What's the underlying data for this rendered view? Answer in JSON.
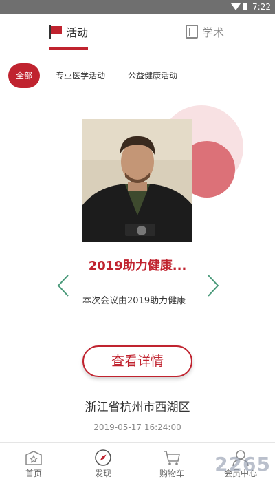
{
  "status_bar": {
    "time": "7:22"
  },
  "top_tabs": [
    {
      "label": "活动",
      "icon": "flag-icon",
      "active": true
    },
    {
      "label": "学术",
      "icon": "book-icon",
      "active": false
    }
  ],
  "filters": [
    {
      "label": "全部",
      "active": true
    },
    {
      "label": "专业医学活动",
      "active": false
    },
    {
      "label": "公益健康活动",
      "active": false
    }
  ],
  "event": {
    "title": "2019助力健康...",
    "description": "本次会议由2019助力健康",
    "detail_button": "查看详情",
    "location": "浙江省杭州市西湖区",
    "datetime": "2019-05-17 16:24:00"
  },
  "bottom_nav": [
    {
      "label": "首页",
      "icon": "home-box-icon"
    },
    {
      "label": "发现",
      "icon": "compass-icon"
    },
    {
      "label": "购物车",
      "icon": "cart-icon"
    },
    {
      "label": "会员中心",
      "icon": "user-icon"
    }
  ],
  "colors": {
    "accent": "#c0232f",
    "arrow": "#4a9a7a",
    "circle_light": "#f8e1e3",
    "circle_dark": "#dc7178"
  },
  "watermark": "2265"
}
